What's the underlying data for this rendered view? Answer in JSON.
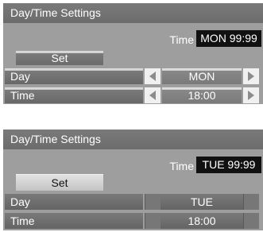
{
  "panels": [
    {
      "title": "Day/Time Settings",
      "time_label": "Time",
      "time_value": "MON  99:99",
      "set_label": "Set",
      "rows": [
        {
          "label": "Day",
          "value": "MON"
        },
        {
          "label": "Time",
          "value": "18:00"
        }
      ]
    },
    {
      "title": "Day/Time Settings",
      "time_label": "Time",
      "time_value": "TUE  99:99",
      "set_label": "Set",
      "rows": [
        {
          "label": "Day",
          "value": "TUE"
        },
        {
          "label": "Time",
          "value": "18:00"
        }
      ]
    }
  ],
  "icons": {
    "left": "arrow-left-icon",
    "right": "arrow-right-icon"
  },
  "colors": {
    "title_bar": "#6c6c6c",
    "panel_body": "#9e9e9e",
    "clock_bg": "#111111",
    "arrow_bg": "#f0f0f0"
  }
}
